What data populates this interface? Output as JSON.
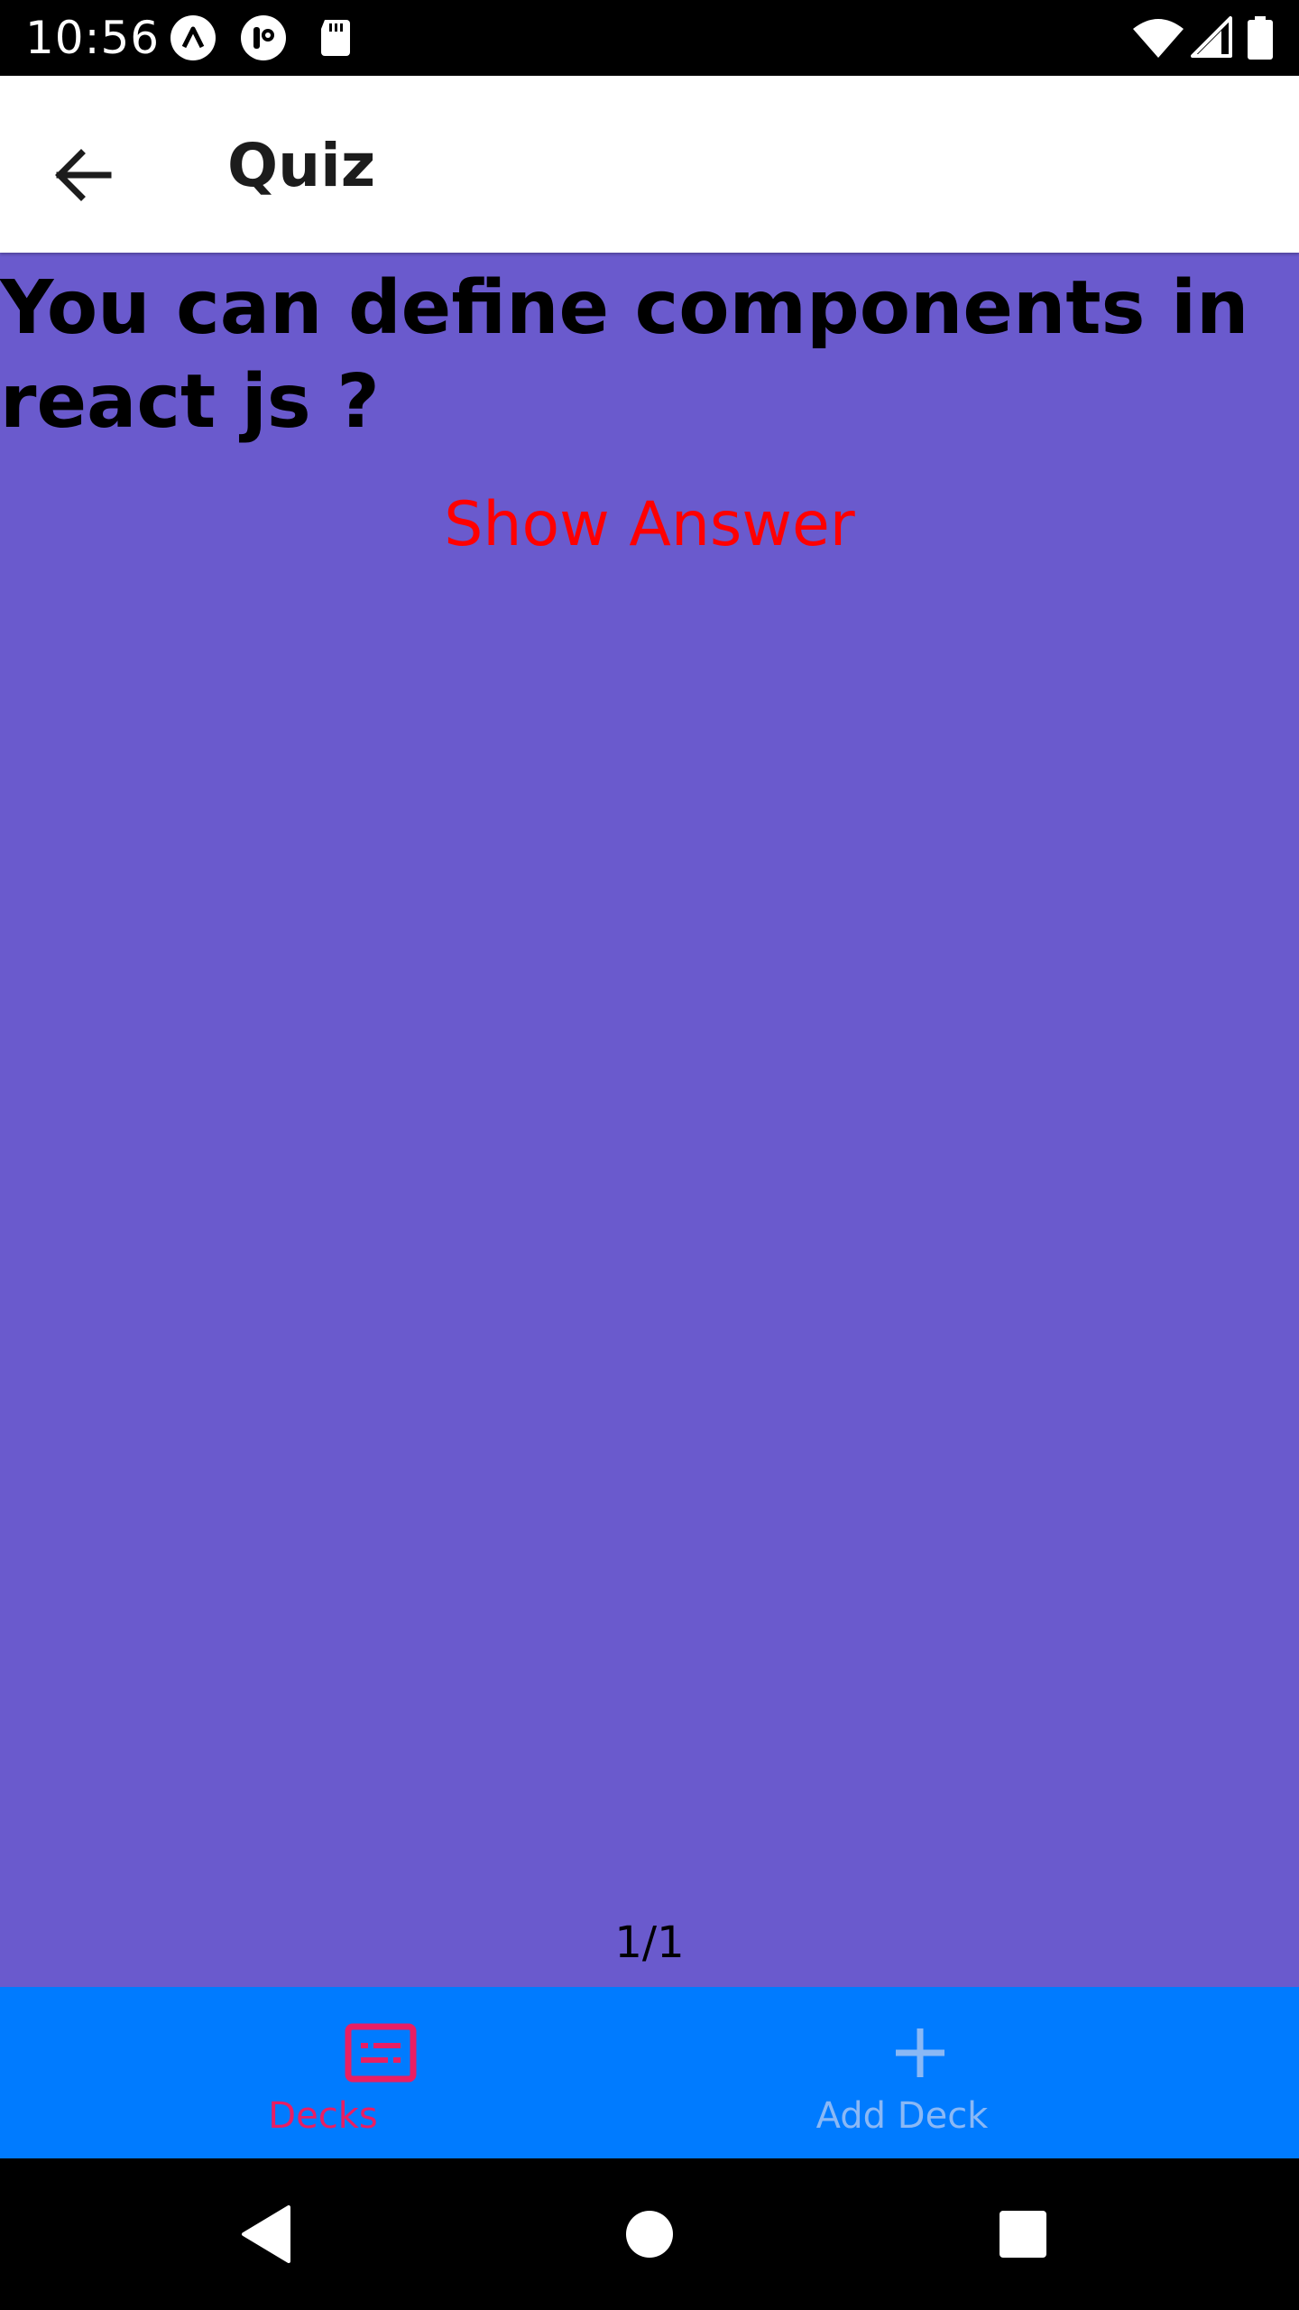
{
  "status_bar": {
    "time": "10:56",
    "left_icons": [
      "launcher-a-icon",
      "notification-icon",
      "sd-card-icon"
    ],
    "right_icons": [
      "wifi-icon",
      "cell-signal-icon",
      "battery-icon"
    ]
  },
  "app_bar": {
    "title": "Quiz",
    "back_icon": "arrow-left-icon"
  },
  "quiz": {
    "question": "You can define components in react js ?",
    "show_answer_label": "Show Answer",
    "progress": "1/1"
  },
  "tabs": [
    {
      "label": "Decks",
      "icon": "deck-card-icon",
      "active": true,
      "color": "#e91e63"
    },
    {
      "label": "Add Deck",
      "icon": "plus-icon",
      "active": false,
      "color": "#8ab8f5"
    }
  ],
  "colors": {
    "background": "#6a5acd",
    "tab_bar": "#007bff",
    "answer_link": "#ff0000"
  }
}
